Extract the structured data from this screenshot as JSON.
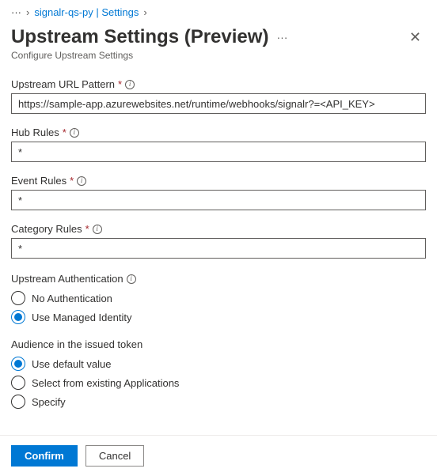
{
  "breadcrumb": {
    "more": "···",
    "link": "signalr-qs-py | Settings",
    "chevron": "›"
  },
  "header": {
    "title": "Upstream Settings (Preview)",
    "context_dots": "···",
    "subtitle": "Configure Upstream Settings"
  },
  "fields": {
    "url": {
      "label": "Upstream URL Pattern",
      "required": "*",
      "value": "https://sample-app.azurewebsites.net/runtime/webhooks/signalr?=<API_KEY>"
    },
    "hub": {
      "label": "Hub Rules",
      "required": "*",
      "value": "*"
    },
    "event": {
      "label": "Event Rules",
      "required": "*",
      "value": "*"
    },
    "category": {
      "label": "Category Rules",
      "required": "*",
      "value": "*"
    }
  },
  "auth": {
    "label": "Upstream Authentication",
    "options": {
      "none": "No Authentication",
      "managed": "Use Managed Identity"
    }
  },
  "audience": {
    "label": "Audience in the issued token",
    "options": {
      "default": "Use default value",
      "select": "Select from existing Applications",
      "specify": "Specify"
    }
  },
  "footer": {
    "confirm": "Confirm",
    "cancel": "Cancel"
  },
  "info_glyph": "i"
}
